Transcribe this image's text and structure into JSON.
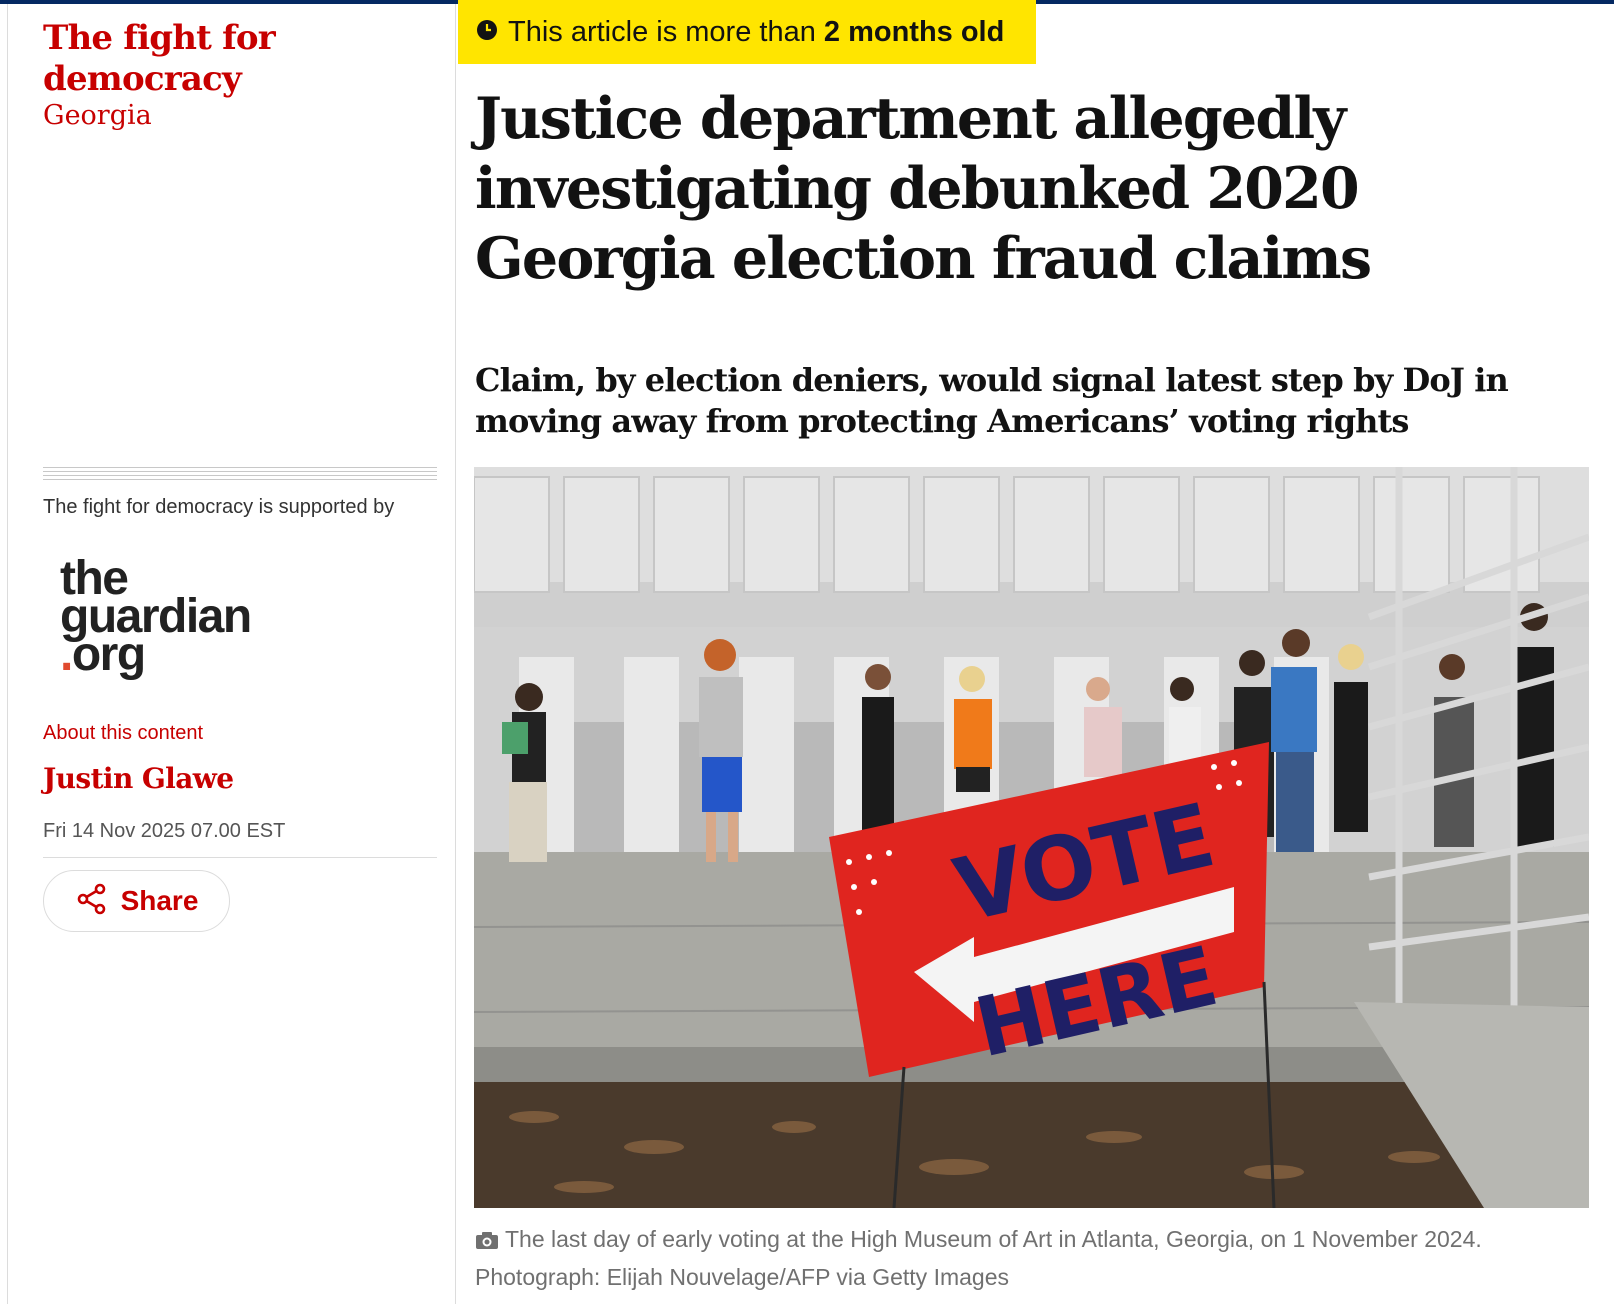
{
  "series": {
    "title": "The fight for democracy",
    "subtitle": "Georgia"
  },
  "sponsor": {
    "supported_by": "The fight for democracy is supported by",
    "logo": {
      "line1": "the",
      "line2": "guardian",
      "line3": ".org"
    },
    "about_link": "About this content"
  },
  "meta": {
    "author": "Justin Glawe",
    "date": "Fri 14 Nov 2025 07.00 EST",
    "share_label": "Share"
  },
  "age_notice": {
    "prefix": "This article is more than ",
    "age": "2 months old",
    "icon": "clock-icon"
  },
  "article": {
    "headline": "Justice department allegedly investigating debunked 2020 Georgia election fraud claims",
    "standfirst": "Claim, by election deniers, would signal latest step by DoJ in moving away from protecting Americans’ voting rights"
  },
  "photo": {
    "sign_line1": "VOTE",
    "sign_line2": "HERE",
    "caption": "The last day of early voting at the High Museum of Art in Atlanta, Georgia, on 1 November 2024.",
    "credit": "Photograph: Elijah Nouvelage/AFP via Getty Images"
  },
  "colors": {
    "brand_red": "#c70000",
    "age_yellow": "#ffe500",
    "top_bar": "#052962"
  }
}
